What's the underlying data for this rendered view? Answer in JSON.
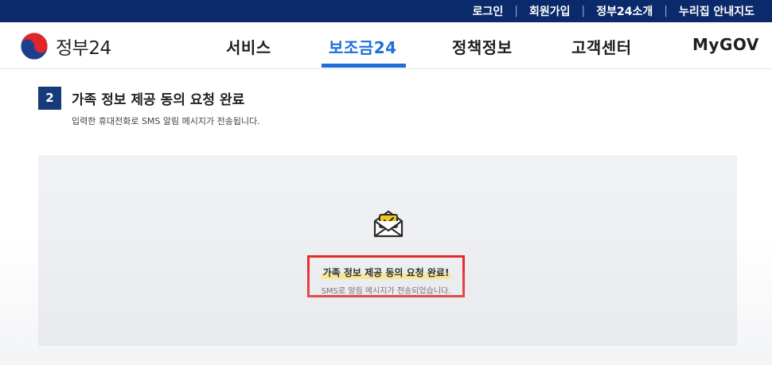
{
  "topbar": {
    "links": [
      "로그인",
      "회원가입",
      "정부24소개",
      "누리집 안내지도"
    ],
    "separator": "|"
  },
  "header": {
    "logo_text": "정부24",
    "nav": [
      {
        "label": "서비스",
        "active": false
      },
      {
        "label": "보조금24",
        "active": true
      },
      {
        "label": "정책정보",
        "active": false
      },
      {
        "label": "고객센터",
        "active": false
      },
      {
        "label": "MyGOV",
        "active": false
      }
    ]
  },
  "step": {
    "number": "2",
    "title": "가족 정보 제공 동의 요청 완료",
    "description": "입력한 휴대전화로 SMS 알림 메시지가 전송됩니다."
  },
  "result": {
    "icon": "envelope-check-icon",
    "title": "가족 정보 제공 동의 요청 완료!",
    "message": "SMS로 알림 메시지가 전송되었습니다."
  },
  "colors": {
    "topbar_bg": "#0b2a6b",
    "accent": "#1e6fd9",
    "step_badge": "#163a7a",
    "highlight_border": "#e31c1c",
    "highlight_marker": "#fde68a"
  }
}
